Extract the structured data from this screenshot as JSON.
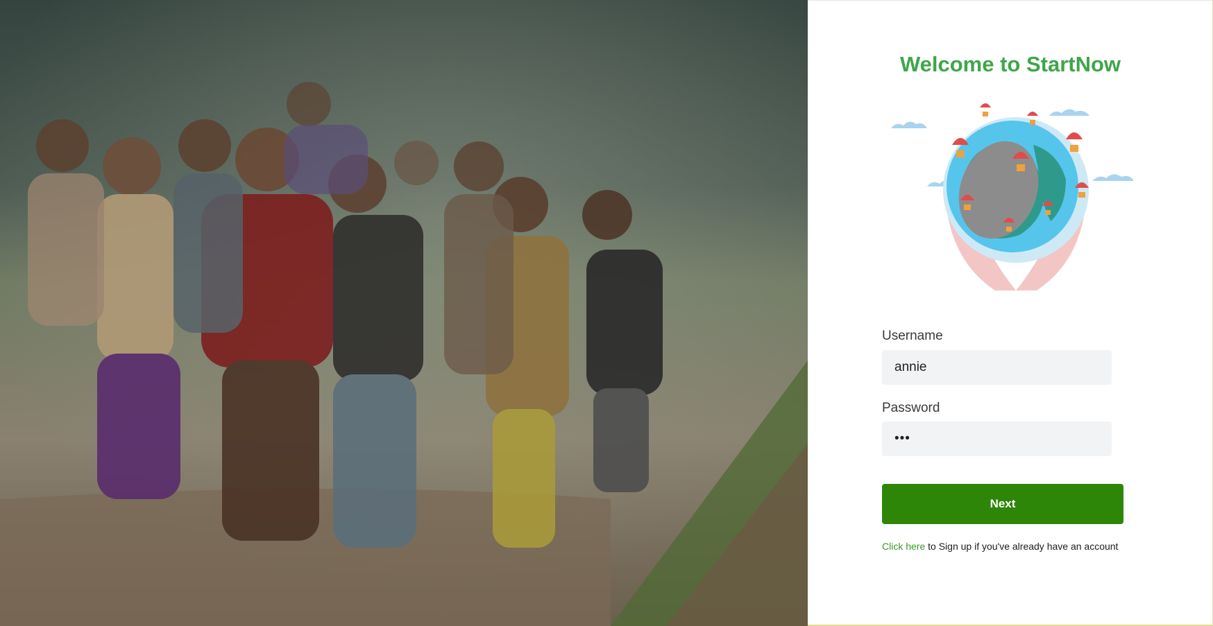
{
  "hero": {
    "image_description_icon": "children-running-photo-icon"
  },
  "login": {
    "title": "Welcome to StartNow",
    "username_label": "Username",
    "username_value": "annie",
    "password_label": "Password",
    "password_value": "•••",
    "next_label": "Next",
    "signup_link": "Click here",
    "signup_text": " to Sign up if you've already have an account"
  },
  "colors": {
    "title_green": "#3fa64a",
    "button_green": "#2e8609",
    "link_green": "#3a9a2a",
    "input_bg": "#f2f3f5"
  },
  "illustration": {
    "icon": "globe-in-hands-with-parachutes-icon"
  }
}
